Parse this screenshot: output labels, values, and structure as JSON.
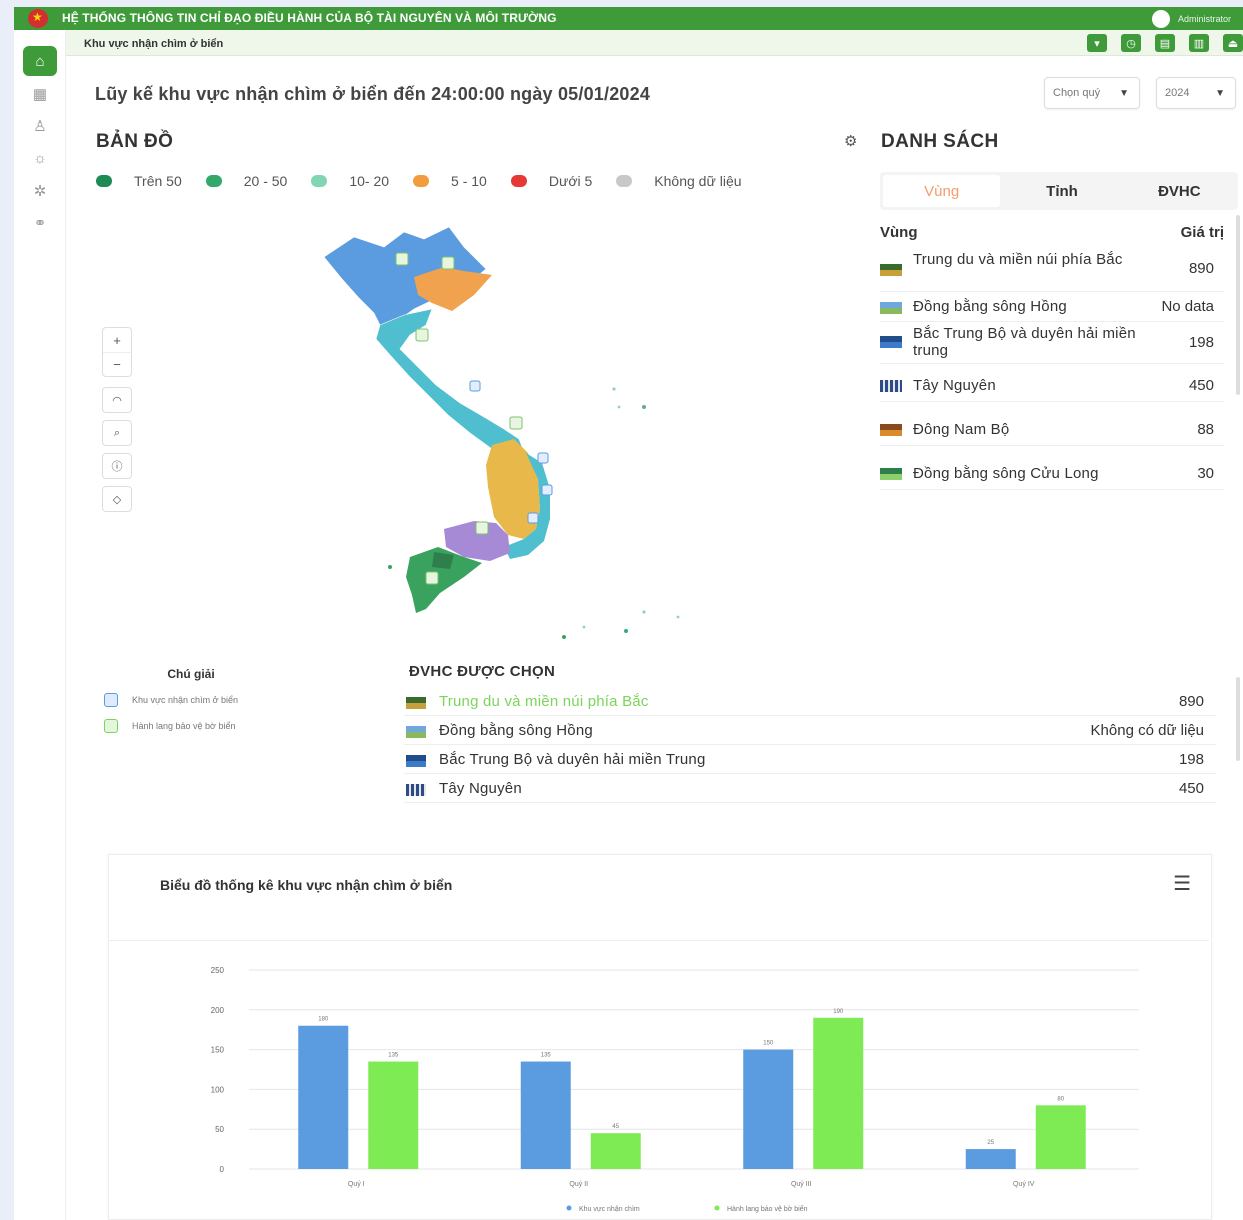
{
  "topbar": {
    "title": "HỆ THỐNG THÔNG TIN CHỈ ĐẠO ĐIỀU HÀNH CỦA BỘ TÀI NGUYÊN VÀ MÔI TRƯỜNG",
    "user": "Administrator"
  },
  "sidebar": {
    "items": [
      "home-icon",
      "building-icon",
      "people-icon",
      "sun-icon",
      "settings-icon",
      "binoculars-icon"
    ]
  },
  "subheader": {
    "breadcrumb": "Khu vực nhận chìm ở biển",
    "tools": [
      "filter-icon",
      "clock-icon",
      "grid-icon",
      "chart-icon",
      "logout-icon"
    ]
  },
  "page": {
    "title": "Lũy kế khu vực nhận chìm ở biển đến 24:00:00 ngày 05/01/2024",
    "quarter_select": "Chọn quý",
    "year_select": "2024"
  },
  "map_section": {
    "title": "BẢN ĐỒ",
    "legend": [
      {
        "label": "Trên 50",
        "color": "#2e8b57"
      },
      {
        "label": "20 - 50",
        "color": "#3cb371"
      },
      {
        "label": "10- 20",
        "color": "#66cdaa"
      },
      {
        "label": "5 - 10",
        "color": "#f39c3d"
      },
      {
        "label": "Dưới 5",
        "color": "#e53935"
      },
      {
        "label": "Không dữ liệu",
        "color": "#bdbdbd"
      }
    ],
    "controls": [
      "+",
      "−"
    ],
    "tool_icons": [
      "layers-icon",
      "search-icon",
      "info-icon",
      "basemap-icon"
    ]
  },
  "chu_giai": {
    "title": "Chú giải",
    "items": [
      {
        "label": "Khu vực nhận chìm ở biển",
        "color": "#4a90d9"
      },
      {
        "label": "Hành lang bảo vệ bờ biển",
        "color": "#7ad65b"
      }
    ]
  },
  "selected": {
    "title": "ĐVHC ĐƯỢC CHỌN",
    "rows": [
      {
        "name": "Trung du và miền núi phía Bắc",
        "value": "890"
      },
      {
        "name": "Đồng bằng sông Hồng",
        "value": "Không có dữ liệu"
      },
      {
        "name": "Bắc Trung Bộ và duyên hải miền Trung",
        "value": "198"
      },
      {
        "name": "Tây Nguyên",
        "value": "450"
      }
    ]
  },
  "list": {
    "title": "DANH SÁCH",
    "tabs": [
      "Vùng",
      "Tỉnh",
      "ĐVHC"
    ],
    "col_name": "Vùng",
    "col_value": "Giá trị",
    "rows": [
      {
        "name": "Trung du và miền núi phía Bắc",
        "value": "890"
      },
      {
        "name": "Đồng bằng sông Hồng",
        "value": "No data"
      },
      {
        "name": "Bắc Trung Bộ và duyên hải miền trung",
        "value": "198"
      },
      {
        "name": "Tây Nguyên",
        "value": "450"
      },
      {
        "name": "Đông Nam Bộ",
        "value": "88"
      },
      {
        "name": "Đồng bằng sông Cửu Long",
        "value": "30"
      }
    ]
  },
  "chart_section": {
    "title": "Biểu đồ thống kê khu vực nhận chìm ở biển"
  },
  "chart_data": {
    "type": "bar",
    "categories": [
      "Quý I",
      "Quý II",
      "Quý III",
      "Quý IV"
    ],
    "series": [
      {
        "name": "Khu vực nhận chìm",
        "color": "#5b9be0",
        "values": [
          180,
          135,
          150,
          25
        ]
      },
      {
        "name": "Hành lang bảo vệ bờ biển",
        "color": "#7eeb55",
        "values": [
          135,
          45,
          190,
          80
        ]
      }
    ],
    "ylim": [
      0,
      250
    ],
    "yticks": [
      0,
      50,
      100,
      150,
      200,
      250
    ],
    "grid": true,
    "legend": "bottom"
  }
}
